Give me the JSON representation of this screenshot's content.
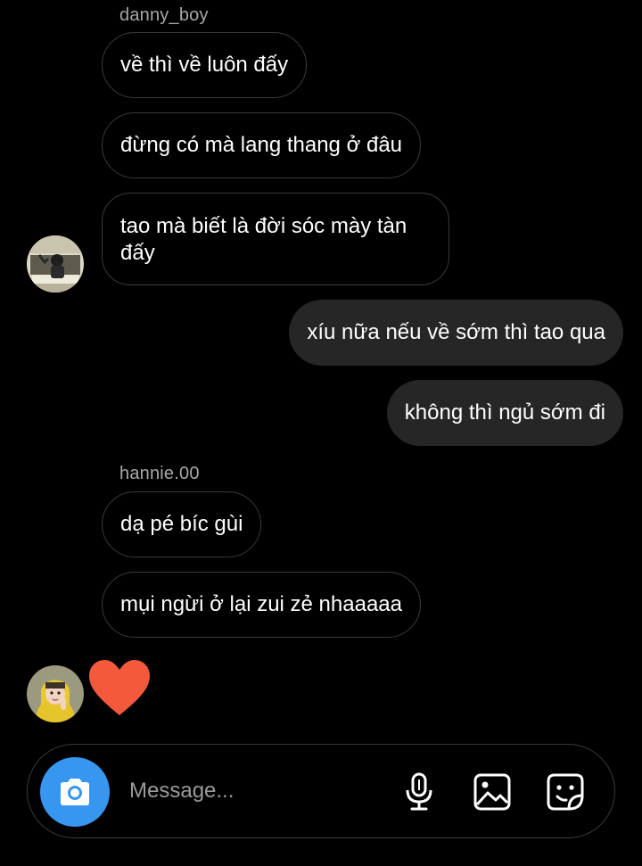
{
  "thread": {
    "groups": [
      {
        "sender": "danny_boy",
        "messages": [
          "về thì về luôn đấy",
          "đừng có mà lang thang ở đâu",
          "tao mà biết là đời sóc mày tàn đấy"
        ]
      },
      {
        "sender": "me",
        "messages": [
          "xíu nữa nếu về sớm thì tao qua",
          "không thì ngủ sớm đi"
        ]
      },
      {
        "sender": "hannie.00",
        "messages": [
          "dạ pé bíc gùi",
          "mụi ngừi ở lại zui zẻ nhaaaaa"
        ],
        "reaction": "heart"
      }
    ]
  },
  "composer": {
    "placeholder": "Message...",
    "camera_icon": "camera-icon",
    "mic_icon": "microphone-icon",
    "gallery_icon": "image-icon",
    "sticker_icon": "sticker-icon"
  },
  "colors": {
    "background": "#000000",
    "incoming_border": "#3a3a3a",
    "outgoing_bubble": "#262626",
    "accent": "#3797f0",
    "heart": "#f4593c",
    "sender_name": "#a8a8a8"
  }
}
